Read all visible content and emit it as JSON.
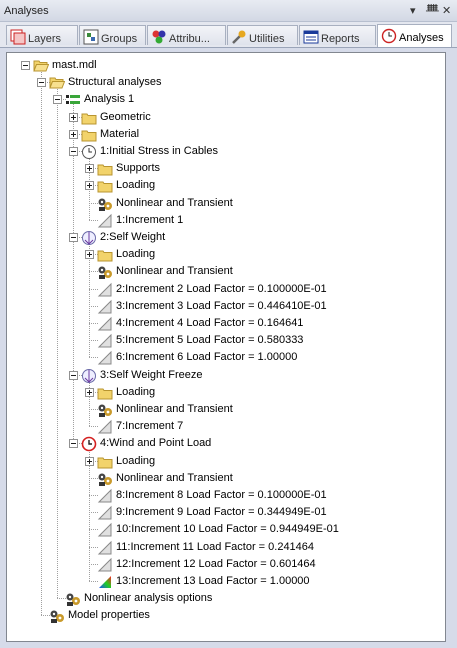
{
  "window": {
    "title": "Analyses",
    "controls": {
      "menu": "▾",
      "pin": "ᚙ",
      "close": "✕"
    }
  },
  "tabs": [
    {
      "label": "Layers",
      "icon": "layers-icon"
    },
    {
      "label": "Groups",
      "icon": "groups-icon"
    },
    {
      "label": "Attribu...",
      "icon": "attributes-icon"
    },
    {
      "label": "Utilities",
      "icon": "utilities-icon"
    },
    {
      "label": "Reports",
      "icon": "reports-icon"
    },
    {
      "label": "Analyses",
      "icon": "analyses-icon",
      "active": true
    }
  ],
  "tree": [
    {
      "label": "mast.mdl",
      "icon": "folder-open-icon",
      "level": 0,
      "expander": "minus"
    },
    {
      "label": "Structural analyses",
      "icon": "folder-open-icon",
      "level": 1,
      "expander": "minus"
    },
    {
      "label": "Analysis 1",
      "icon": "analysis-icon",
      "level": 2,
      "expander": "minus"
    },
    {
      "label": "Geometric",
      "icon": "folder-icon",
      "level": 3,
      "expander": "plus"
    },
    {
      "label": "Material",
      "icon": "folder-icon",
      "level": 3,
      "expander": "plus"
    },
    {
      "label": "1:Initial Stress in Cables",
      "icon": "clock-icon",
      "level": 3,
      "expander": "minus"
    },
    {
      "label": "Supports",
      "icon": "folder-icon",
      "level": 4,
      "expander": "plus"
    },
    {
      "label": "Loading",
      "icon": "folder-icon",
      "level": 4,
      "expander": "plus"
    },
    {
      "label": "Nonlinear and Transient",
      "icon": "gears-icon",
      "level": 4,
      "expander": "none"
    },
    {
      "label": "1:Increment 1",
      "icon": "increment-icon",
      "level": 4,
      "expander": "none"
    },
    {
      "label": "2:Self Weight",
      "icon": "self-weight-icon",
      "level": 3,
      "expander": "minus"
    },
    {
      "label": "Loading",
      "icon": "folder-icon",
      "level": 4,
      "expander": "plus"
    },
    {
      "label": "Nonlinear and Transient",
      "icon": "gears-icon",
      "level": 4,
      "expander": "none"
    },
    {
      "label": "2:Increment 2 Load Factor = 0.100000E-01",
      "icon": "increment-icon",
      "level": 4,
      "expander": "none"
    },
    {
      "label": "3:Increment 3 Load Factor = 0.446410E-01",
      "icon": "increment-icon",
      "level": 4,
      "expander": "none"
    },
    {
      "label": "4:Increment 4 Load Factor = 0.164641",
      "icon": "increment-icon",
      "level": 4,
      "expander": "none"
    },
    {
      "label": "5:Increment 5 Load Factor = 0.580333",
      "icon": "increment-icon",
      "level": 4,
      "expander": "none"
    },
    {
      "label": "6:Increment 6 Load Factor = 1.00000",
      "icon": "increment-icon",
      "level": 4,
      "expander": "none"
    },
    {
      "label": "3:Self Weight Freeze",
      "icon": "self-weight-icon",
      "level": 3,
      "expander": "minus"
    },
    {
      "label": "Loading",
      "icon": "folder-icon",
      "level": 4,
      "expander": "plus"
    },
    {
      "label": "Nonlinear and Transient",
      "icon": "gears-icon",
      "level": 4,
      "expander": "none"
    },
    {
      "label": "7:Increment 7",
      "icon": "increment-icon",
      "level": 4,
      "expander": "none"
    },
    {
      "label": "4:Wind and Point Load",
      "icon": "clock-red-icon",
      "level": 3,
      "expander": "minus"
    },
    {
      "label": "Loading",
      "icon": "folder-icon",
      "level": 4,
      "expander": "plus"
    },
    {
      "label": "Nonlinear and Transient",
      "icon": "gears-icon",
      "level": 4,
      "expander": "none"
    },
    {
      "label": "8:Increment 8 Load Factor = 0.100000E-01",
      "icon": "increment-icon",
      "level": 4,
      "expander": "none"
    },
    {
      "label": "9:Increment 9 Load Factor = 0.344949E-01",
      "icon": "increment-icon",
      "level": 4,
      "expander": "none"
    },
    {
      "label": "10:Increment 10 Load Factor = 0.944949E-01",
      "icon": "increment-icon",
      "level": 4,
      "expander": "none"
    },
    {
      "label": "11:Increment 11 Load Factor = 0.241464",
      "icon": "increment-icon",
      "level": 4,
      "expander": "none"
    },
    {
      "label": "12:Increment 12 Load Factor = 0.601464",
      "icon": "increment-icon",
      "level": 4,
      "expander": "none"
    },
    {
      "label": "13:Increment 13 Load Factor = 1.00000",
      "icon": "increment-colored-icon",
      "level": 4,
      "expander": "none"
    },
    {
      "label": "Nonlinear analysis options",
      "icon": "gears-icon",
      "level": 2,
      "expander": "none"
    },
    {
      "label": "Model properties",
      "icon": "gears-icon",
      "level": 1,
      "expander": "none"
    }
  ],
  "colors": {
    "folder": "#f2d36b",
    "folder_edge": "#b89530",
    "analysis_green": "#3aa63a",
    "clock_red": "#d42020",
    "selection_tab": "#ffffff"
  }
}
